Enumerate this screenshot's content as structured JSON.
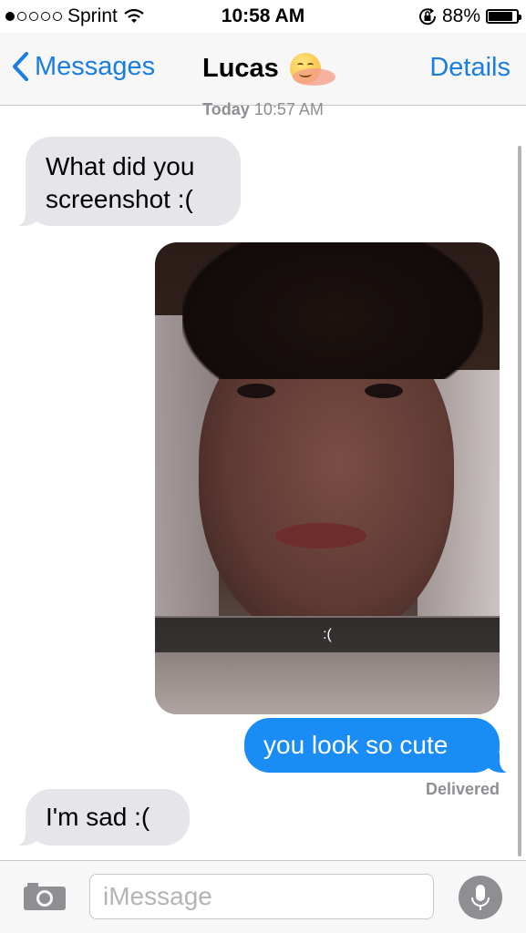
{
  "status_bar": {
    "carrier": "Sprint",
    "signal_dots_filled": 1,
    "signal_dots_total": 5,
    "time": "10:58 AM",
    "battery_percent": "88%",
    "battery_level": 0.88
  },
  "nav": {
    "back_label": "Messages",
    "title": "Lucas",
    "details_label": "Details",
    "accent_color": "#1a7de0"
  },
  "thread": {
    "timestamp_day": "Today",
    "timestamp_time": "10:57 AM",
    "messages": [
      {
        "direction": "incoming",
        "text": "What did you screenshot :("
      },
      {
        "direction": "outgoing",
        "type": "image",
        "caption": ":("
      },
      {
        "direction": "outgoing",
        "text": "you look so cute"
      },
      {
        "direction": "incoming",
        "text": "I'm sad :("
      }
    ],
    "delivery_status": "Delivered"
  },
  "input_bar": {
    "placeholder": "iMessage",
    "camera_icon": "camera-icon",
    "mic_icon": "microphone-icon"
  },
  "colors": {
    "incoming_bubble": "#e5e5ea",
    "outgoing_bubble": "#1a8cf6"
  }
}
